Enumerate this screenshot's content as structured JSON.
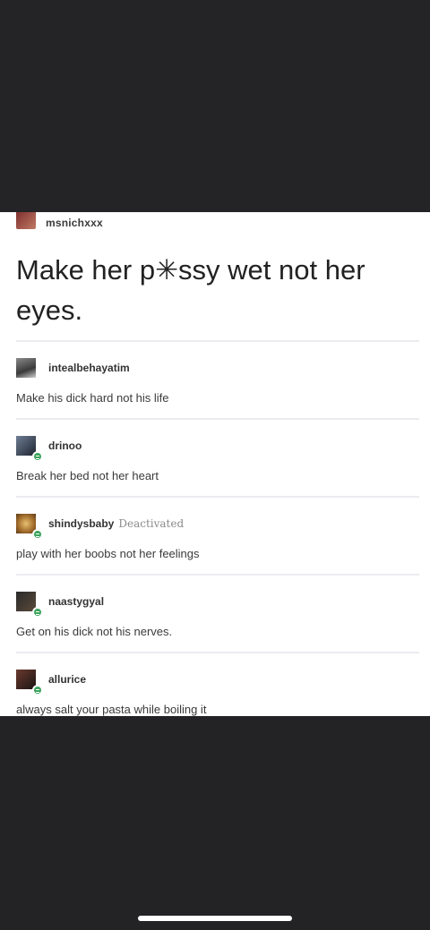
{
  "post": {
    "op": {
      "username": "msnichxxx",
      "text": "Make her p✳ssy wet not her eyes."
    },
    "replies": [
      {
        "username": "intealbehayatim",
        "status": "",
        "text": "Make his dick hard not his life",
        "avatar_color": "#5a5a5a"
      },
      {
        "username": "drinoo",
        "status": "",
        "text": "Break her bed not her heart",
        "avatar_color": "#2f3a4a"
      },
      {
        "username": "shindysbaby",
        "status": "Deactivated",
        "text": "play with her boobs not her feelings",
        "avatar_color": "#b8893a"
      },
      {
        "username": "naastygyal",
        "status": "",
        "text": "Get on his dick not his nerves.",
        "avatar_color": "#1f1f1f"
      },
      {
        "username": "allurice",
        "status": "",
        "text": "always salt your pasta while boiling it",
        "avatar_color": "#3a2420"
      }
    ]
  }
}
